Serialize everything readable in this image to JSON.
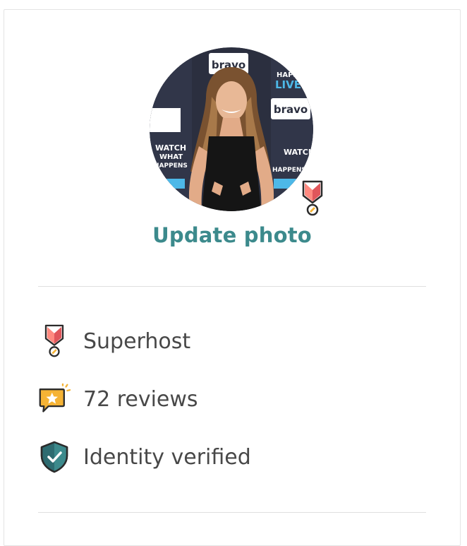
{
  "profile": {
    "update_photo_label": "Update photo",
    "photo_backdrop_text": [
      "bravo",
      "HAPPY",
      "LIVE",
      "WATCH",
      "WHAT",
      "HAPPENS"
    ]
  },
  "stats": {
    "superhost_label": "Superhost",
    "reviews_label": "72 reviews",
    "identity_label": "Identity verified"
  },
  "colors": {
    "accent_teal": "#3c8a8c",
    "superhost_red": "#e0565b",
    "superhost_pink": "#ff8a80",
    "review_yellow": "#f5b335",
    "shield_teal": "#2d6b70"
  },
  "icons": {
    "superhost": "superhost-medal-icon",
    "reviews": "review-star-bubble-icon",
    "identity": "verified-shield-icon"
  }
}
